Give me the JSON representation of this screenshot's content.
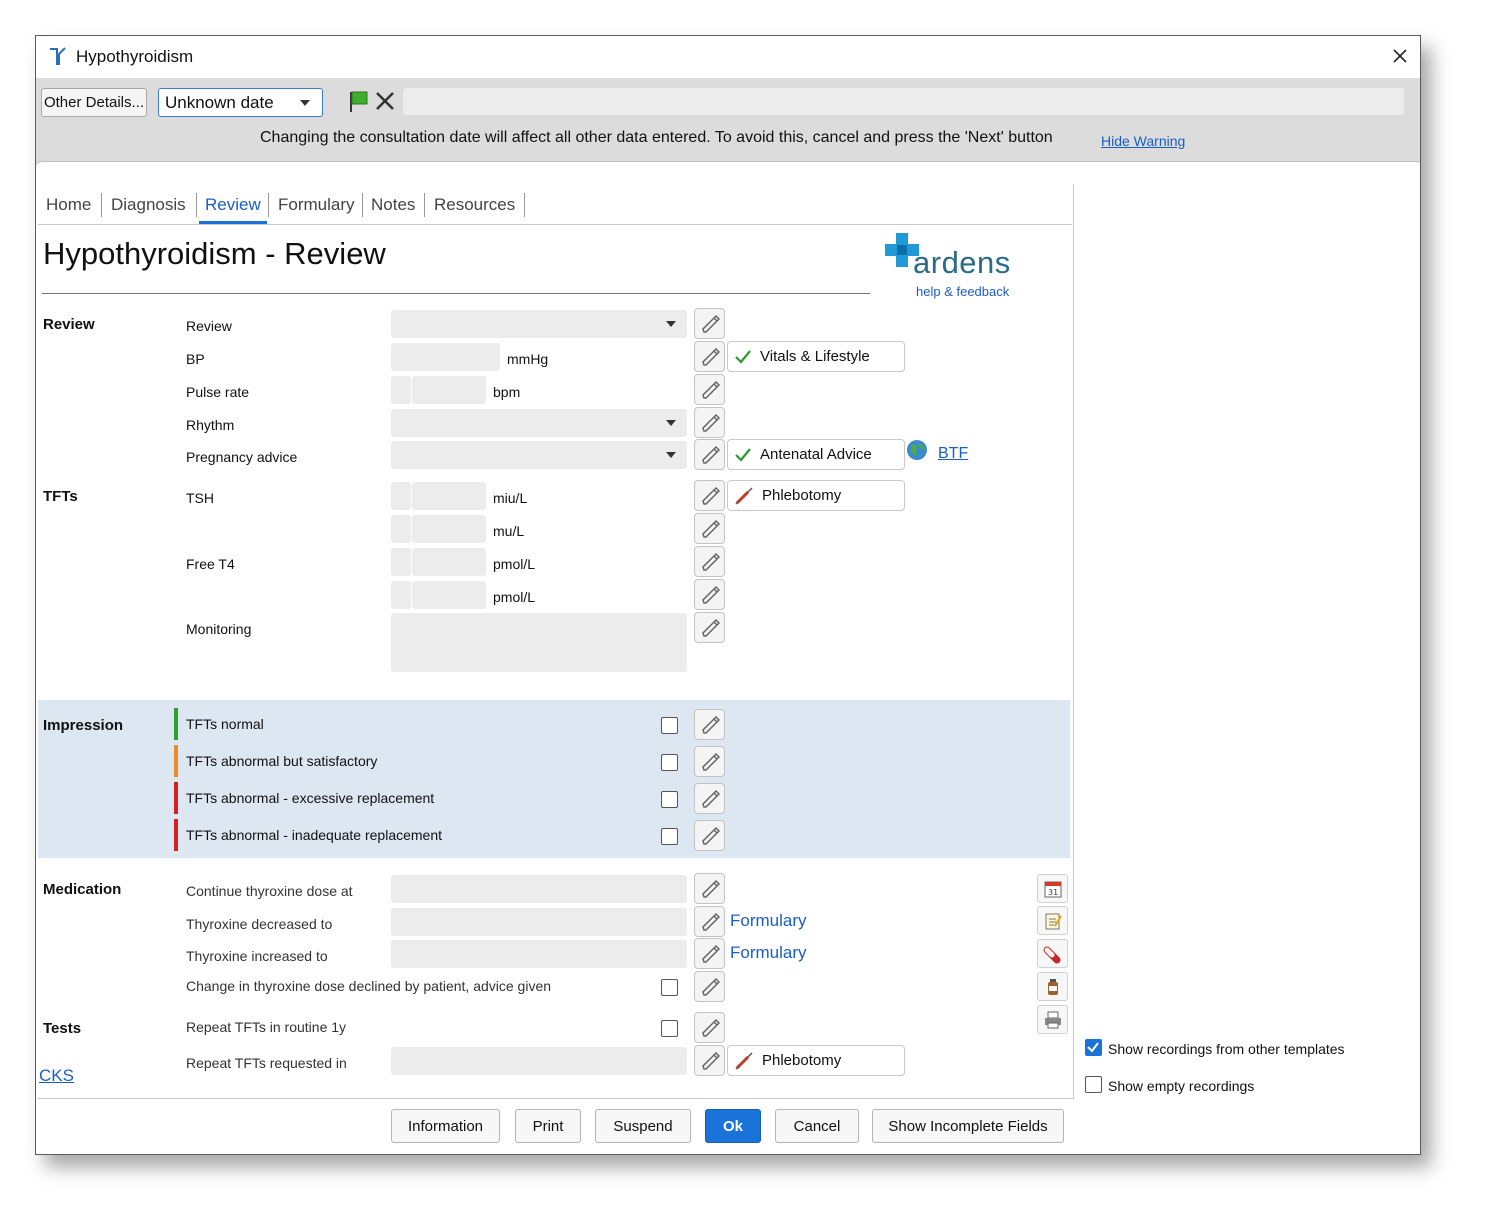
{
  "window": {
    "title": "Hypothyroidism"
  },
  "toolbar": {
    "other_details": "Other Details...",
    "date_value": "Unknown date",
    "warning": "Changing the consultation date will affect all other data entered. To avoid this, cancel and press the 'Next' button",
    "hide_warning": "Hide Warning"
  },
  "tabs": [
    "Home",
    "Diagnosis",
    "Review",
    "Formulary",
    "Notes",
    "Resources"
  ],
  "active_tab": "Review",
  "page_title": "Hypothyroidism - Review",
  "logo": {
    "name": "ardens",
    "help": "help & feedback"
  },
  "sections": {
    "review": "Review",
    "tfts": "TFTs",
    "impression": "Impression",
    "medication": "Medication",
    "tests": "Tests"
  },
  "review_rows": {
    "review": "Review",
    "bp": "BP",
    "bp_unit": "mmHg",
    "pulse": "Pulse rate",
    "pulse_unit": "bpm",
    "rhythm": "Rhythm",
    "pregnancy": "Pregnancy advice"
  },
  "tft_rows": {
    "tsh": "TSH",
    "tsh_unit1": "miu/L",
    "tsh_unit2": "mu/L",
    "ft4": "Free T4",
    "ft4_unit1": "pmol/L",
    "ft4_unit2": "pmol/L",
    "monitoring": "Monitoring"
  },
  "chips": {
    "vitals": "Vitals & Lifestyle",
    "antenatal": "Antenatal Advice",
    "btf": "BTF",
    "phlebotomy": "Phlebotomy"
  },
  "impressions": [
    {
      "label": "TFTs normal",
      "color": "#2da02d"
    },
    {
      "label": "TFTs abnormal but satisfactory",
      "color": "#f08a24"
    },
    {
      "label": "TFTs abnormal - excessive replacement",
      "color": "#d62020"
    },
    {
      "label": "TFTs abnormal - inadequate replacement",
      "color": "#d62020"
    }
  ],
  "medication_rows": {
    "continue": "Continue thyroxine dose at",
    "decreased": "Thyroxine decreased to",
    "increased": "Thyroxine increased to",
    "declined": "Change in thyroxine dose declined by patient, advice given",
    "formulary": "Formulary"
  },
  "tests_rows": {
    "repeat_routine": "Repeat TFTs in routine 1y",
    "repeat_requested": "Repeat TFTs requested in"
  },
  "cks": "CKS",
  "options": {
    "show_other": "Show recordings from other templates",
    "show_other_checked": true,
    "show_empty": "Show empty recordings",
    "show_empty_checked": false
  },
  "buttons": {
    "information": "Information",
    "print": "Print",
    "suspend": "Suspend",
    "ok": "Ok",
    "cancel": "Cancel",
    "incomplete": "Show Incomplete Fields"
  },
  "colors": {
    "accent": "#1a73d9",
    "link": "#1a5ec5",
    "ok_button": "#1a73d9"
  }
}
